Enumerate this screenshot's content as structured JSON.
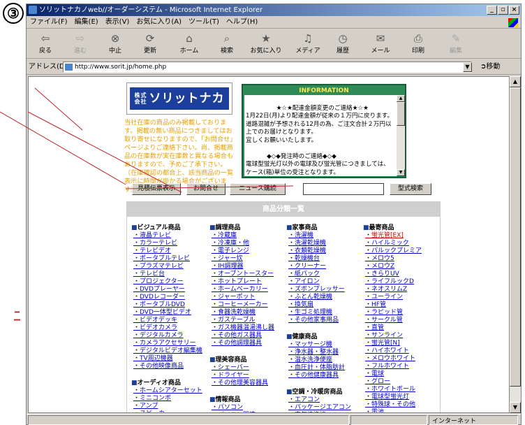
{
  "annotation": {
    "number": "③",
    "mark": "ﾆ"
  },
  "window": {
    "title": "ソリットナカノweb//オーダーシステム - Microsoft Internet Explorer",
    "controls": [
      "_",
      "▫",
      "×"
    ]
  },
  "menu": [
    "ファイル(F)",
    "編集(E)",
    "表示(V)",
    "お気に入り(A)",
    "ツール(T)",
    "ヘルプ(H)"
  ],
  "toolbar": [
    {
      "label": "戻る",
      "icon": "back-icon",
      "glyph": "⇦"
    },
    {
      "label": "進む",
      "icon": "forward-icon",
      "glyph": "⇨",
      "disabled": true
    },
    {
      "label": "中止",
      "icon": "stop-icon",
      "glyph": "⊗"
    },
    {
      "label": "更新",
      "icon": "refresh-icon",
      "glyph": "⟳"
    },
    {
      "label": "ホーム",
      "icon": "home-icon",
      "glyph": "⌂"
    },
    {
      "label": "検索",
      "icon": "search-icon",
      "glyph": "⌕"
    },
    {
      "label": "お気に入り",
      "icon": "favorites-icon",
      "glyph": "★"
    },
    {
      "label": "メディア",
      "icon": "media-icon",
      "glyph": "♫"
    },
    {
      "label": "履歴",
      "icon": "history-icon",
      "glyph": "◷"
    },
    {
      "label": "メール",
      "icon": "mail-icon",
      "glyph": "✉"
    },
    {
      "label": "印刷",
      "icon": "print-icon",
      "glyph": "⎙"
    },
    {
      "label": "編集",
      "icon": "edit-icon",
      "glyph": "✎",
      "disabled": true
    }
  ],
  "address": {
    "label": "アドレス(D)",
    "url": "http://www.sorit.jp/home.php",
    "go": "移動"
  },
  "page": {
    "logo": {
      "prefix": "株式会社",
      "name": "ソリットナカノ"
    },
    "notice": "当社在庫の商品のみ掲載しております。掲載の無い商品につきましてはお取り寄せになりますので、「お問合せ」ページよりご連絡下さい。尚、掲載商品の在庫数が実在庫数と異なる場合もありますので、予めご了承下さい。（在庫確認の都合上、該当商品の一覧表示に時間が掛かる場合がございます）",
    "info": {
      "title": "INFORMATION",
      "body": "      ★☆★配達金額変更のご連絡★☆★\n1月22日(月)より配達金額が従来の１万円に戻ります。\n道路混雑が予想される12月の為、ご注文合計２万円以上でのお届けとなります。\n宜しくお願いいたします。\n\n           ◆◇◆発注時のご連絡◆◇◆\n電球型蛍光灯以外の電球及び蛍光管につきましては、ケース(箱)単位の受注となります。"
    },
    "nav_buttons": [
      "見積伝票表示",
      "お問合せ",
      "ニュース購読"
    ],
    "search_button": "型式検索",
    "category_title": "商品分類一覧",
    "categories": [
      {
        "col": 0,
        "title": "ビジュアル商品",
        "items": [
          "液晶テレビ",
          "カラーテレビ",
          "テレビデオ",
          "ポータブルテレビ",
          "プラズマテレビ",
          "テレビ台",
          "プロジェクター",
          "DVDプレーヤー",
          "DVDレコーダー",
          "ポータブルDVD",
          "DVD一体型ビデオ",
          "ビデオデッキ",
          "ビデオカメラ",
          "デジタルカメラ",
          "カメラアクセサリー",
          "デジタルビデオ編集機",
          "TV周辺機器",
          "その他映像商品"
        ]
      },
      {
        "col": 0,
        "title": "オーディオ商品",
        "items": [
          "ホームシアターセット",
          "ミニコンポ",
          "アンプ",
          "スピーカー"
        ]
      },
      {
        "col": 1,
        "title": "調理商品",
        "items": [
          "冷蔵庫",
          "冷凍庫・他",
          "電子レンジ",
          "ジャー炊",
          "IH調理器",
          "オーブントースター",
          "ホットプレート",
          "ホームベーカリー",
          "ジャーポット",
          "コーヒーメーカー",
          "食器洗乾燥機",
          "ガステーブル",
          "ガス機器温湯沸し器",
          "その他ガス器具",
          "その他調理器具"
        ]
      },
      {
        "col": 1,
        "title": "理美容商品",
        "items": [
          "シェーバー",
          "ドライヤー",
          "その他理美容器具"
        ]
      },
      {
        "col": 1,
        "title": "情報商品",
        "items": [
          "パソコン",
          "パソコン関連"
        ]
      },
      {
        "col": 2,
        "title": "家事商品",
        "items": [
          "洗濯機",
          "洗濯乾燥機",
          "衣類乾燥機",
          "乾燥機台",
          "クリーナー",
          "紙パック",
          "アイロン",
          "ズボンプレッサー",
          "ふとん乾燥機",
          "換気扇",
          "生ゴミ処理機",
          "その他家事用品"
        ]
      },
      {
        "col": 2,
        "title": "健康商品",
        "items": [
          "マッサージ機",
          "浄水器・整水器",
          "温水洗浄便座",
          "血圧計・体脂肪計",
          "その他健康器具"
        ]
      },
      {
        "col": 2,
        "title": "空調・冷暖房商品",
        "items": [
          "エアコン",
          "パッケージエアコン",
          "空気清浄機"
        ]
      },
      {
        "col": 3,
        "title": "最寄商品",
        "items": [
          "蛍光管[EX]",
          "ハイルミック",
          "パルックプレミア",
          "メロウ5",
          "メロウZ",
          "きらりUV",
          "ライフルックD",
          "ネオスリムZ",
          "ユーライン",
          "HF管",
          "ラピッド管",
          "サークル管",
          "直管",
          "サンライン",
          "蛍光管[N]",
          "ハイホワイト",
          "メロウホワイト",
          "フルホワイト",
          "電球",
          "グロー",
          "ホワイトボール",
          "電球型蛍光灯",
          "特殊球・その他",
          "電池"
        ]
      }
    ]
  },
  "status": {
    "text": "",
    "zone": "インターネット"
  }
}
